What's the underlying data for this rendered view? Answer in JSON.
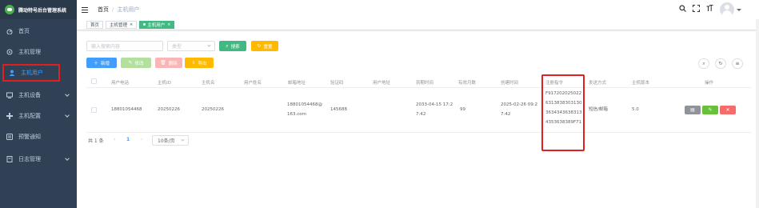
{
  "app": {
    "logo_text": "腾动特号后台管理系统"
  },
  "sidebar": {
    "items": [
      {
        "label": "首页",
        "icon": "dashboard-icon"
      },
      {
        "label": "主机管理",
        "icon": "monitor-icon"
      },
      {
        "label": "主机用户",
        "icon": "user-icon",
        "active": true
      },
      {
        "label": "主机设备",
        "icon": "device-icon",
        "has_children": true
      },
      {
        "label": "主机配置",
        "icon": "config-icon",
        "has_children": true
      },
      {
        "label": "预警通知",
        "icon": "alert-icon"
      },
      {
        "label": "日志管理",
        "icon": "log-icon",
        "has_children": true
      }
    ]
  },
  "header": {
    "breadcrumb": [
      "首页",
      "/",
      "主机用户"
    ]
  },
  "tags": [
    {
      "label": "首页"
    },
    {
      "label": "主机管理",
      "closable": true
    },
    {
      "label": "主机用户",
      "closable": true,
      "active": true
    }
  ],
  "search": {
    "placeholder": "输入搜索内容",
    "type_placeholder": "类型",
    "search_label": "搜索",
    "reset_label": "重置"
  },
  "toolbar": {
    "add": "新增",
    "edit": "修改",
    "delete": "删除",
    "export": "导出"
  },
  "table": {
    "columns": [
      "用户电话",
      "主机ID",
      "主机名",
      "用户姓名",
      "邮箱地址",
      "验证码",
      "用户地址",
      "到期时间",
      "有效月数",
      "创建时间",
      "注册指令",
      "发送方式",
      "主机版本",
      "操作"
    ],
    "rows": [
      {
        "phone": "18801054468",
        "host_id": "20250226",
        "host_name": "20250226",
        "user_name": "",
        "email_1": "18801054468@",
        "email_2": "163.com",
        "code": "145688",
        "address": "",
        "expire_1": "2033-04-15 17:2",
        "expire_2": "7:42",
        "months": "99",
        "created_1": "2025-02-26 09:2",
        "created_2": "7:42",
        "cmd_1": "F917202025022",
        "cmd_2": "6313838303130",
        "cmd_3": "3634343638313",
        "cmd_4": "4353638389F71",
        "send_mode": "短信/邮箱",
        "version": "5.0"
      }
    ]
  },
  "pager": {
    "total": "共 1 条",
    "current": "1",
    "page_size": "10条/页"
  },
  "colors": {
    "sidebar_bg": "#304156",
    "primary": "#409eff",
    "success": "#67c23a",
    "danger": "#f56c6c",
    "warning": "#e6a23c",
    "highlight": "#e02020"
  }
}
